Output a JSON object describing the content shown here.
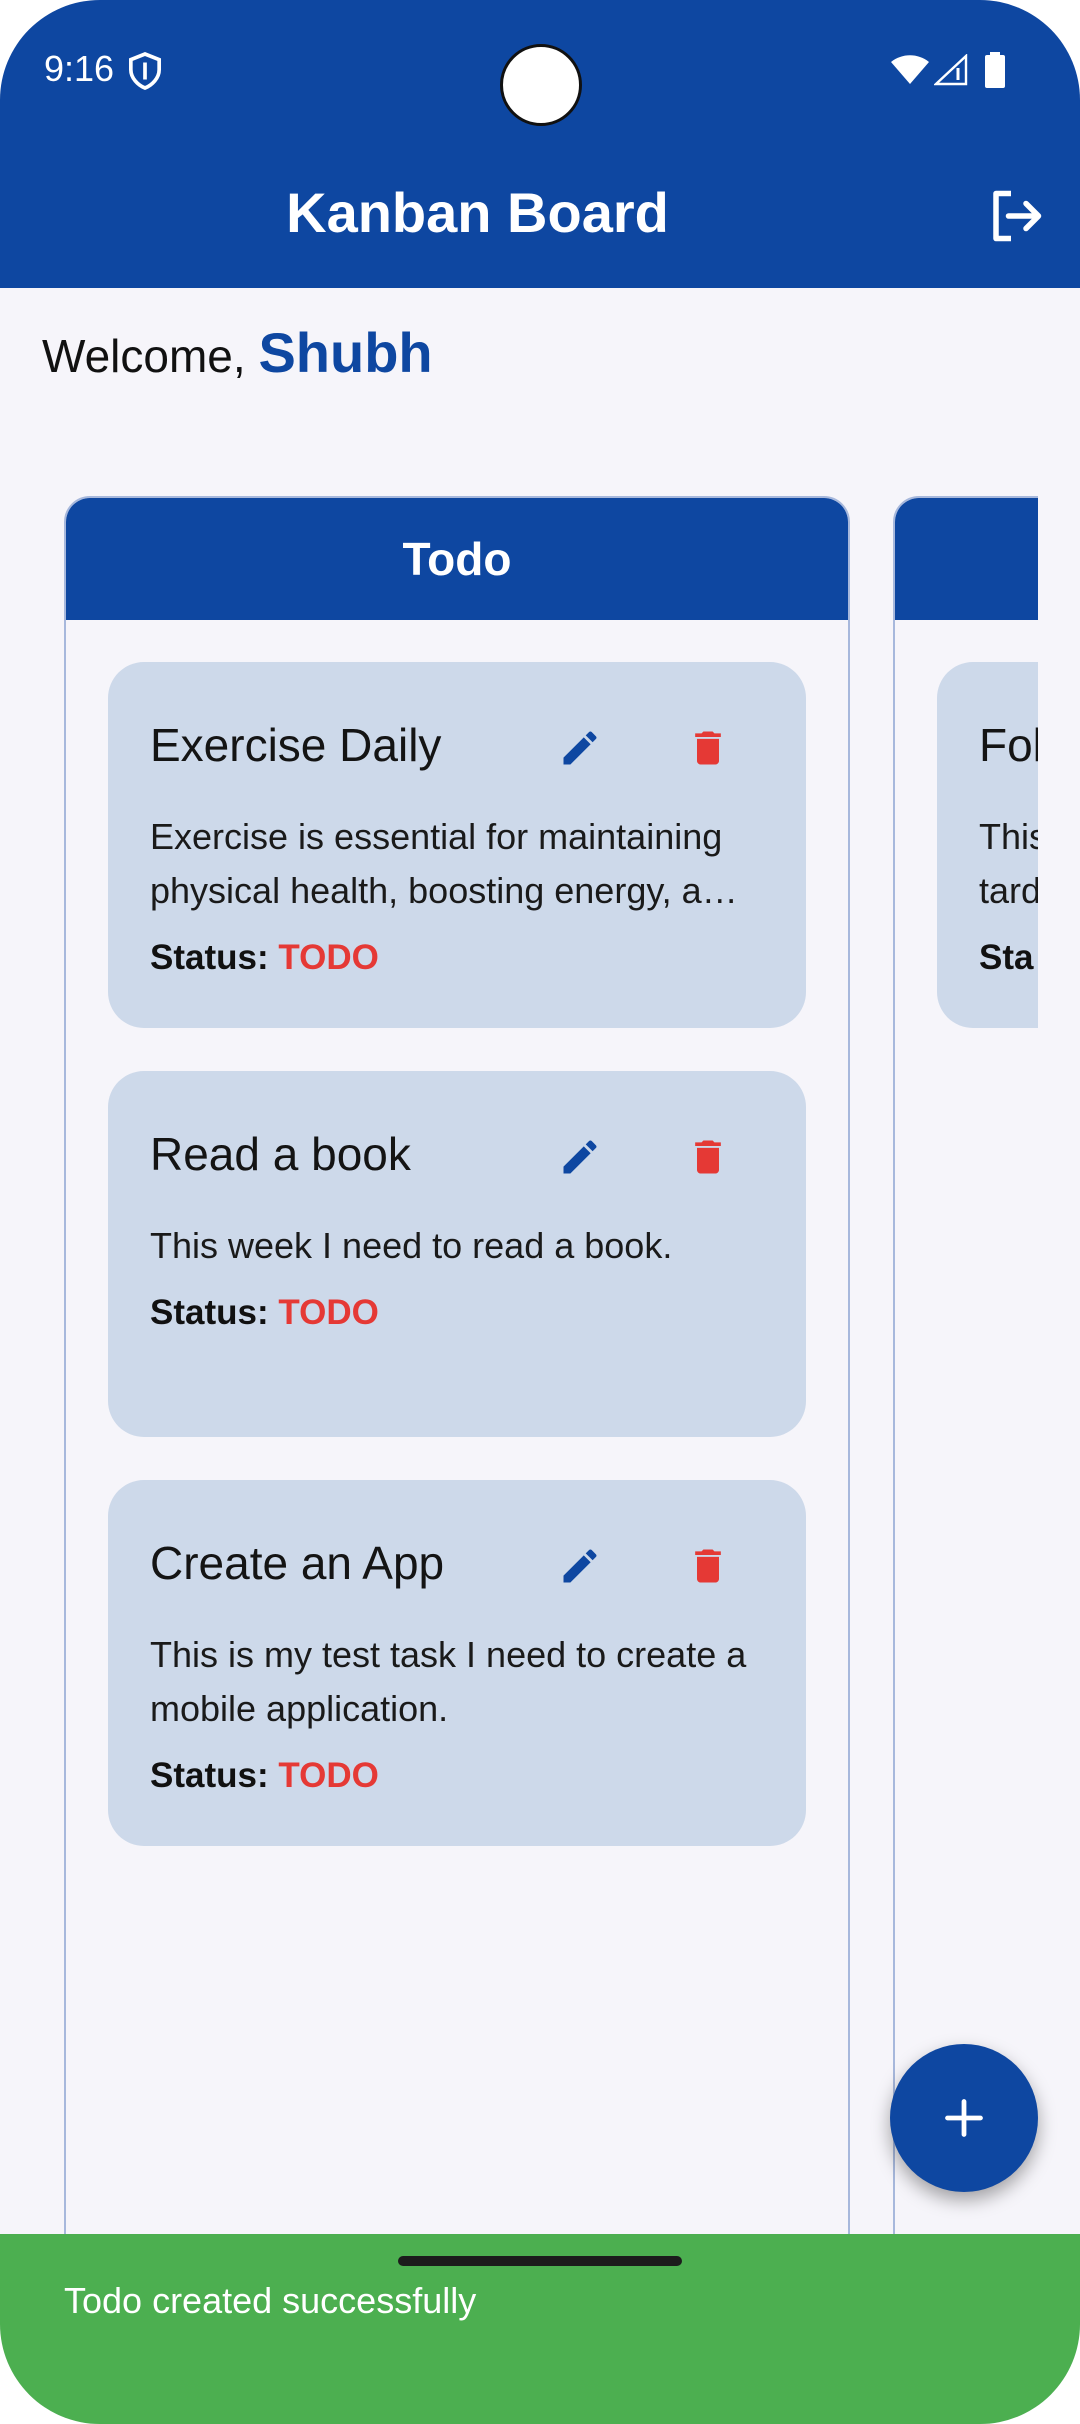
{
  "status_bar": {
    "time": "9:16",
    "icons": [
      "shield-icon",
      "wifi-icon",
      "signal-icon",
      "battery-icon"
    ]
  },
  "app_bar": {
    "title": "Kanban Board",
    "action_icon": "logout-icon"
  },
  "welcome": {
    "prefix": "Welcome,",
    "user": "Shubh"
  },
  "columns": [
    {
      "title": "Todo",
      "cards": [
        {
          "title": "Exercise Daily",
          "description": "Exercise is essential for maintaining physical health, boosting energy, a…",
          "status_label": "Status:",
          "status_value": "TODO"
        },
        {
          "title": "Read a book",
          "description": "This week I need to read a book.",
          "status_label": "Status:",
          "status_value": "TODO"
        },
        {
          "title": "Create an App",
          "description": "This is my test task I need to create a mobile application.",
          "status_label": "Status:",
          "status_value": "TODO"
        }
      ]
    },
    {
      "title": "",
      "cards": [
        {
          "title": "Fol",
          "description": "This tard",
          "status_label": "Sta"
        }
      ]
    }
  ],
  "fab": {
    "icon": "plus-icon"
  },
  "snackbar": {
    "message": "Todo created successfully"
  },
  "colors": {
    "primary": "#0e47a1",
    "card_bg": "#cdd9ea",
    "status_red": "#e53935",
    "snackbar_green": "#4caf50"
  }
}
